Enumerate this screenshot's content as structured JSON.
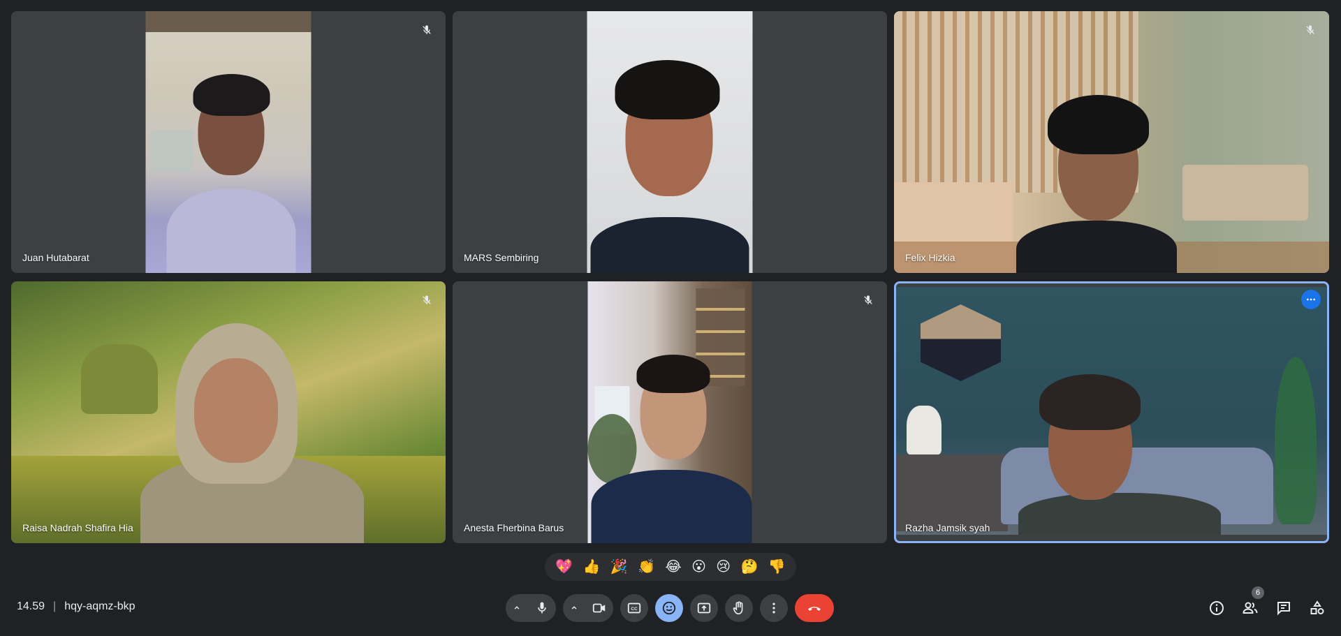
{
  "participants": [
    {
      "name": "Juan Hutabarat",
      "muted": true
    },
    {
      "name": "MARS Sembiring",
      "muted": false
    },
    {
      "name": "Felix Hizkia",
      "muted": true
    },
    {
      "name": "Raisa Nadrah Shafira Hia",
      "muted": true
    },
    {
      "name": "Anesta Fherbina Barus",
      "muted": true
    },
    {
      "name": "Razha Jamsik syah",
      "muted": false,
      "speaking": true
    }
  ],
  "reactions": [
    "💖",
    "👍",
    "🎉",
    "👏",
    "😂",
    "😮",
    "😢",
    "🤔",
    "👎"
  ],
  "meeting": {
    "time": "14.59",
    "code": "hqy-aqmz-bkp"
  },
  "people_count": "6",
  "colors": {
    "background": "#202124",
    "tile": "#3c4043",
    "end_call": "#ea4335",
    "active": "#8ab4f8",
    "speaking_outline": "#8ab4f8"
  }
}
